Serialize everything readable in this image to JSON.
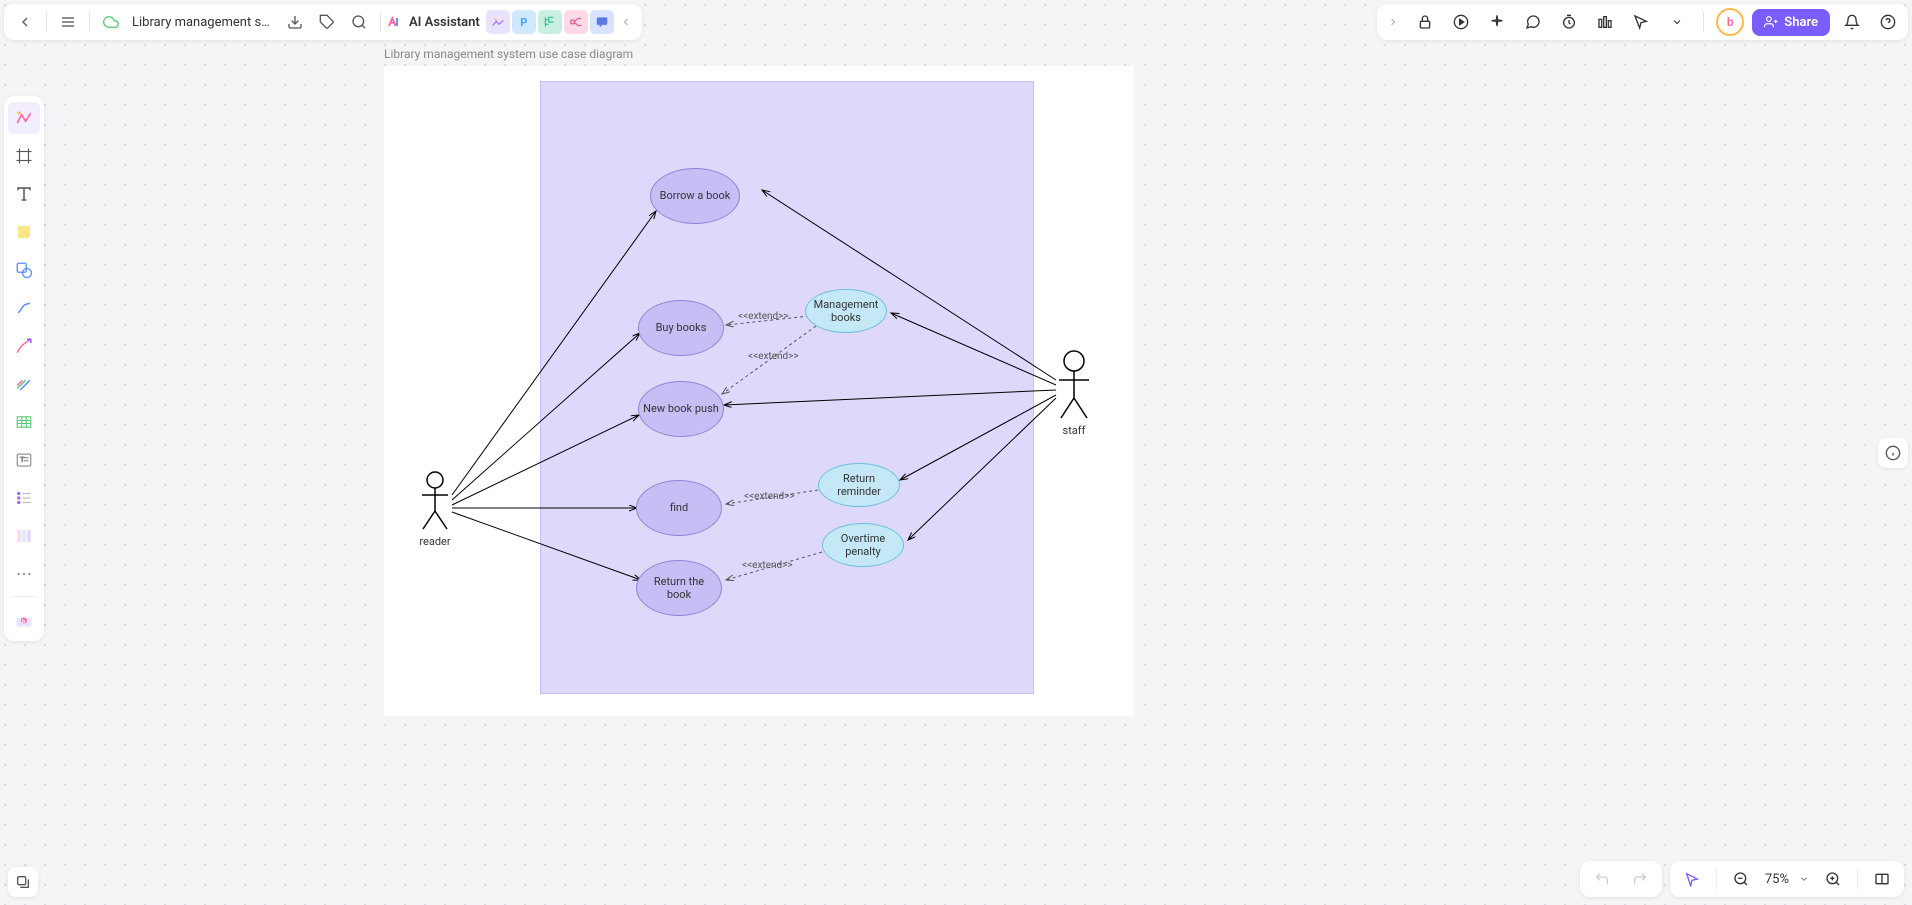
{
  "doc": {
    "name": "Library management sys..."
  },
  "ai": {
    "label": "AI Assistant"
  },
  "share": "Share",
  "zoom": "75%",
  "page": {
    "title": "Library management system use case diagram"
  },
  "actors": {
    "reader": "reader",
    "staff": "staff"
  },
  "usecases": {
    "borrow": "Borrow a book",
    "buy": "Buy books",
    "newpush": "New book push",
    "find": "find",
    "return": "Return the book",
    "manage": "Management books",
    "reminder": "Return reminder",
    "penalty": "Overtime penalty"
  },
  "stereotype": "<<extend>>",
  "avatar": "b"
}
